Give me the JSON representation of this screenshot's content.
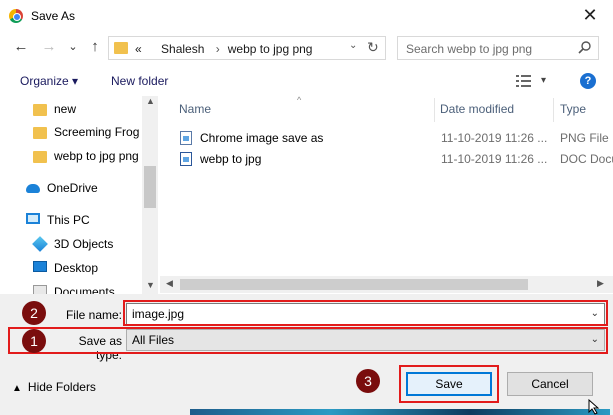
{
  "window": {
    "title": "Save As",
    "close_glyph": "✕"
  },
  "nav": {
    "back_glyph": "←",
    "forward_glyph": "→",
    "recent_glyph": "⌄",
    "up_glyph": "↑",
    "address": {
      "chevron": "«",
      "crumb1": "Shalesh",
      "crumb2": "webp to jpg png",
      "dropdown_glyph": "⌄",
      "refresh_glyph": "↻"
    },
    "search": {
      "placeholder": "Search webp to jpg png"
    }
  },
  "toolbar": {
    "organize": "Organize ▾",
    "new_folder": "New folder",
    "view_menu_glyph": "▾",
    "help_glyph": "?"
  },
  "sidebar": {
    "items": [
      {
        "label": "new",
        "icon": "folder-icon"
      },
      {
        "label": "Screeming Frog",
        "icon": "folder-icon"
      },
      {
        "label": "webp to jpg png",
        "icon": "folder-icon"
      },
      {
        "label": "OneDrive",
        "icon": "onedrive-icon"
      },
      {
        "label": "This PC",
        "icon": "pc-icon"
      },
      {
        "label": "3D Objects",
        "icon": "3d-objects-icon"
      },
      {
        "label": "Desktop",
        "icon": "desktop-icon"
      },
      {
        "label": "Documents",
        "icon": "documents-icon"
      }
    ]
  },
  "files": {
    "columns": {
      "name": "Name",
      "date": "Date modified",
      "type": "Type"
    },
    "rows": [
      {
        "name": "Chrome image save as",
        "date": "11-10-2019 11:26 ...",
        "type": "PNG File"
      },
      {
        "name": "webp to jpg",
        "date": "11-10-2019 11:26 ...",
        "type": "DOC Docu"
      }
    ]
  },
  "form": {
    "file_name_label": "File name:",
    "file_name_value": "image.jpg",
    "save_type_label": "Save as type:",
    "save_type_value": "All Files",
    "dropdown_glyph": "⌄"
  },
  "footer": {
    "hide_folders": "Hide Folders",
    "save": "Save",
    "cancel": "Cancel"
  },
  "annotations": {
    "badge1": "1",
    "badge2": "2",
    "badge3": "3",
    "highlight_color": "#e21b1b",
    "badge_color": "#7a0d0d"
  }
}
